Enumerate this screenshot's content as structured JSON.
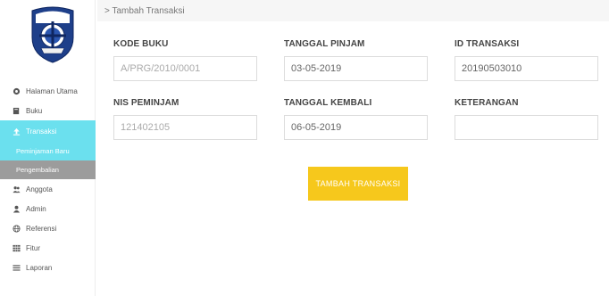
{
  "breadcrumb": "> Tambah Transaksi",
  "sidebar": {
    "items": [
      {
        "label": "Halaman Utama",
        "icon": "dashboard-icon"
      },
      {
        "label": "Buku",
        "icon": "book-icon"
      },
      {
        "label": "Transaksi",
        "icon": "upload-icon"
      },
      {
        "label": "Peminjaman Baru"
      },
      {
        "label": "Pengembalian"
      },
      {
        "label": "Anggota",
        "icon": "users-icon"
      },
      {
        "label": "Admin",
        "icon": "user-icon"
      },
      {
        "label": "Referensi",
        "icon": "globe-icon"
      },
      {
        "label": "Fitur",
        "icon": "grid-icon"
      },
      {
        "label": "Laporan",
        "icon": "list-icon"
      }
    ]
  },
  "form": {
    "kode_buku": {
      "label": "KODE BUKU",
      "placeholder": "A/PRG/2010/0001"
    },
    "tanggal_pinjam": {
      "label": "TANGGAL PINJAM",
      "value": "03-05-2019"
    },
    "id_transaksi": {
      "label": "ID TRANSAKSI",
      "value": "20190503010"
    },
    "nis_peminjam": {
      "label": "NIS PEMINJAM",
      "placeholder": "121402105"
    },
    "tanggal_kembali": {
      "label": "TANGGAL KEMBALI",
      "value": "06-05-2019"
    },
    "keterangan": {
      "label": "KETERANGAN",
      "value": ""
    },
    "submit_label": "TAMBAH TRANSAKSI"
  },
  "colors": {
    "active": "#6be0ee",
    "secondary": "#9c9c9c",
    "button": "#f6c81c",
    "logo_blue": "#1e3f8a"
  }
}
